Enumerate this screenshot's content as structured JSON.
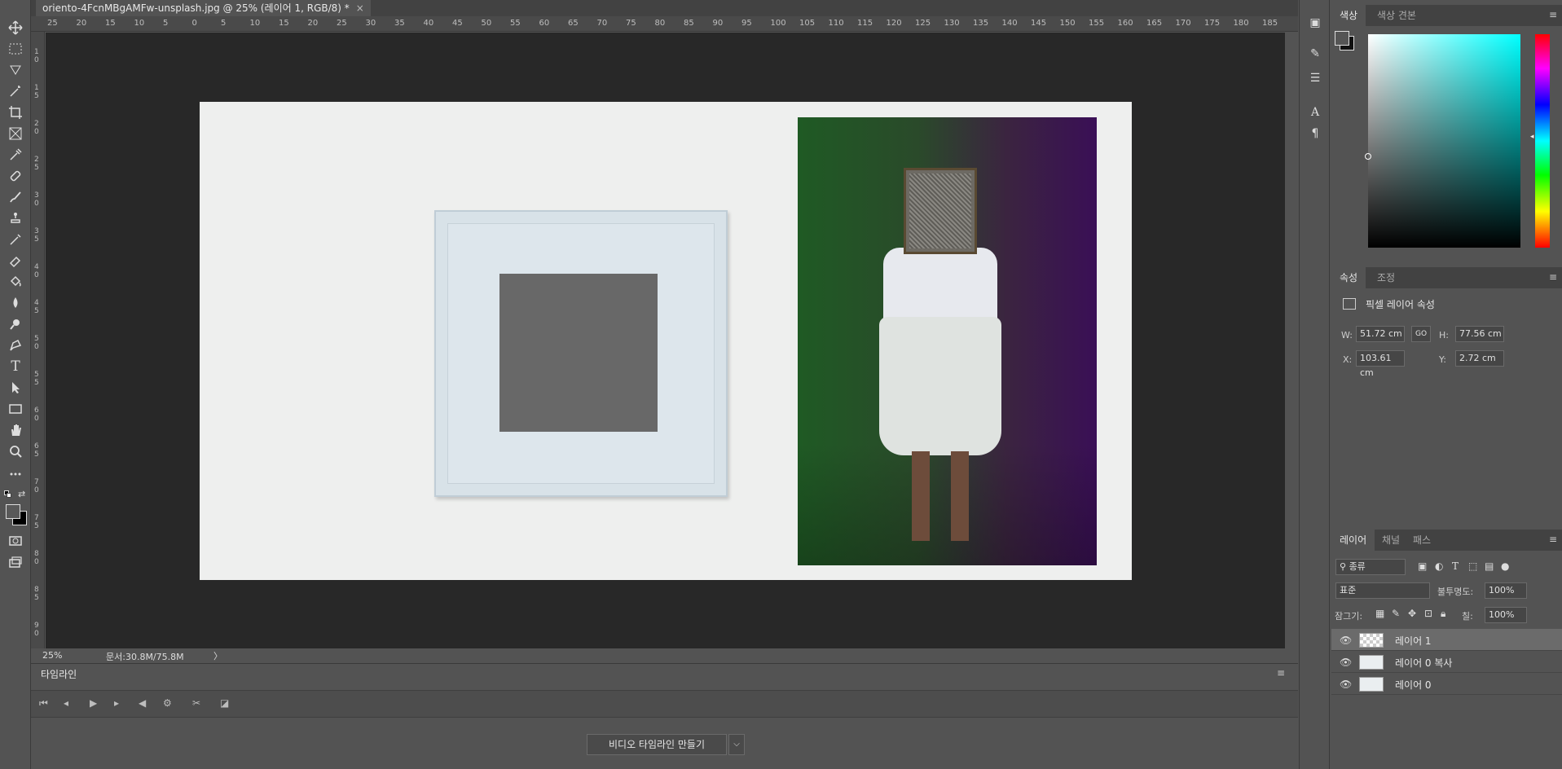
{
  "document": {
    "tab_title": "oriento-4FcnMBgAMFw-unsplash.jpg @ 25% (레이어 1, RGB/8) *",
    "close_glyph": "×"
  },
  "ruler": {
    "h_ticks": [
      "25",
      "20",
      "15",
      "10",
      "5",
      "0",
      "5",
      "10",
      "15",
      "20",
      "25",
      "30",
      "35",
      "40",
      "45",
      "50",
      "55",
      "60",
      "65",
      "70",
      "75",
      "80",
      "85",
      "90",
      "95",
      "100",
      "105",
      "110",
      "115",
      "120",
      "125",
      "130",
      "135",
      "140",
      "145",
      "150",
      "155",
      "160",
      "165",
      "170",
      "175",
      "180",
      "185"
    ],
    "v_ticks": [
      "1 0",
      "1 5",
      "2 0",
      "2 5",
      "3 0",
      "3 5",
      "4 0",
      "4 5",
      "5 0",
      "5 5",
      "6 0",
      "6 5",
      "7 0",
      "7 5",
      "8 0",
      "8 5",
      "9 0"
    ]
  },
  "toolbar": {
    "tools": [
      "move-tool",
      "marquee-tool",
      "lasso-tool",
      "magic-wand-tool",
      "crop-tool",
      "frame-tool",
      "eyedropper-tool",
      "healing-brush-tool",
      "brush-tool",
      "clone-stamp-tool",
      "history-brush-tool",
      "eraser-tool",
      "paint-bucket-tool",
      "blur-tool",
      "dodge-tool",
      "pen-tool",
      "type-tool",
      "path-selection-tool",
      "rectangle-tool",
      "hand-tool",
      "zoom-tool",
      "more-tools",
      "swap-colors",
      "color-swatches",
      "quick-mask",
      "screen-mode"
    ],
    "type_tool_glyph": "T"
  },
  "status": {
    "zoom": "25%",
    "doc_size": "문서:30.8M/75.8M",
    "arrow": "〉"
  },
  "timeline": {
    "tab_label": "타임라인",
    "create_button": "비디오 타임라인 만들기",
    "dropdown_glyph": "⌵",
    "menu_glyph": "≡"
  },
  "color_panel": {
    "tabs": [
      "색상",
      "색상 견본"
    ],
    "active_tab": 0,
    "menu_glyph": "≡",
    "foreground": "#555555",
    "background": "#111111"
  },
  "properties_panel": {
    "tabs": [
      "속성",
      "조정"
    ],
    "active_tab": 0,
    "heading": "픽셀 레이어 속성",
    "w_label": "W:",
    "w_value": "51.72 cm",
    "link_label": "GO",
    "h_label": "H:",
    "h_value": "77.56 cm",
    "x_label": "X:",
    "x_value": "103.61 cm",
    "y_label": "Y:",
    "y_value": "2.72 cm"
  },
  "layers_panel": {
    "tabs": [
      "레이어",
      "채널",
      "패스"
    ],
    "active_tab": 0,
    "filter_label": "종류",
    "blend_mode": "표준",
    "opacity_label": "불투명도:",
    "opacity_value": "100%",
    "lock_label": "잠그기:",
    "fill_label": "칠:",
    "fill_value": "100%",
    "layers": [
      {
        "name": "레이어 1",
        "selected": true
      },
      {
        "name": "레이어 0 복사",
        "selected": false
      },
      {
        "name": "레이어 0",
        "selected": false
      }
    ]
  }
}
